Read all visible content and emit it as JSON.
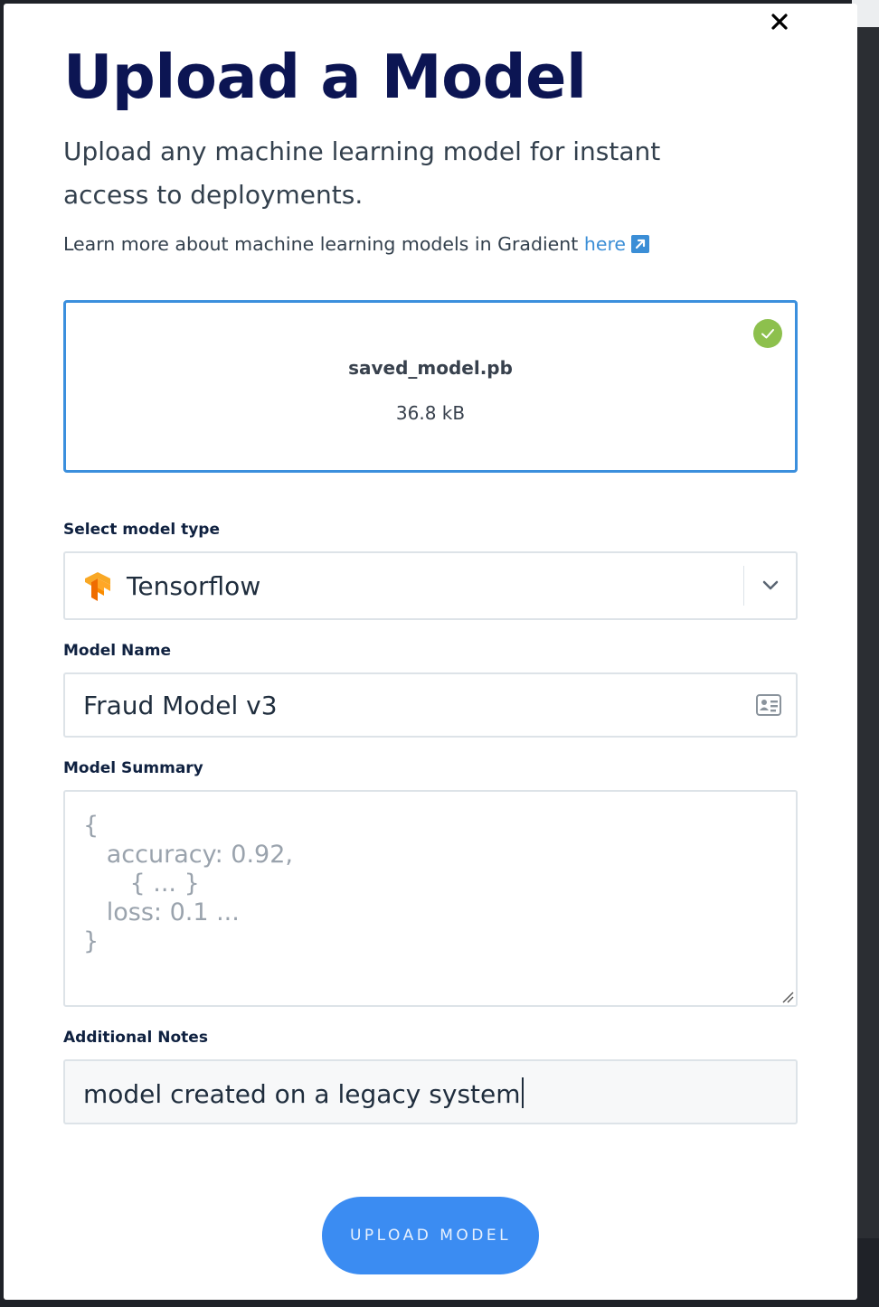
{
  "modal": {
    "title": "Upload a Model",
    "subtitle": "Upload any machine learning model for instant access to deployments.",
    "learn_more_text": "Learn more about machine learning models in Gradient ",
    "learn_more_link": "here"
  },
  "file": {
    "name": "saved_model.pb",
    "size": "36.8 kB",
    "status": "uploaded",
    "status_color": "#8dc04d"
  },
  "model_type": {
    "label": "Select model type",
    "value": "Tensorflow",
    "icon": "tensorflow-icon"
  },
  "model_name": {
    "label": "Model Name",
    "value": "Fraud Model v3",
    "icon": "id-card-icon"
  },
  "model_summary": {
    "label": "Model Summary",
    "placeholder": "{\n   accuracy: 0.92,\n      { ... }\n   loss: 0.1 ...\n}"
  },
  "additional_notes": {
    "label": "Additional Notes",
    "value": "model created on a legacy system"
  },
  "actions": {
    "upload_label": "UPLOAD MODEL",
    "accent_color": "#3b8cf2"
  }
}
